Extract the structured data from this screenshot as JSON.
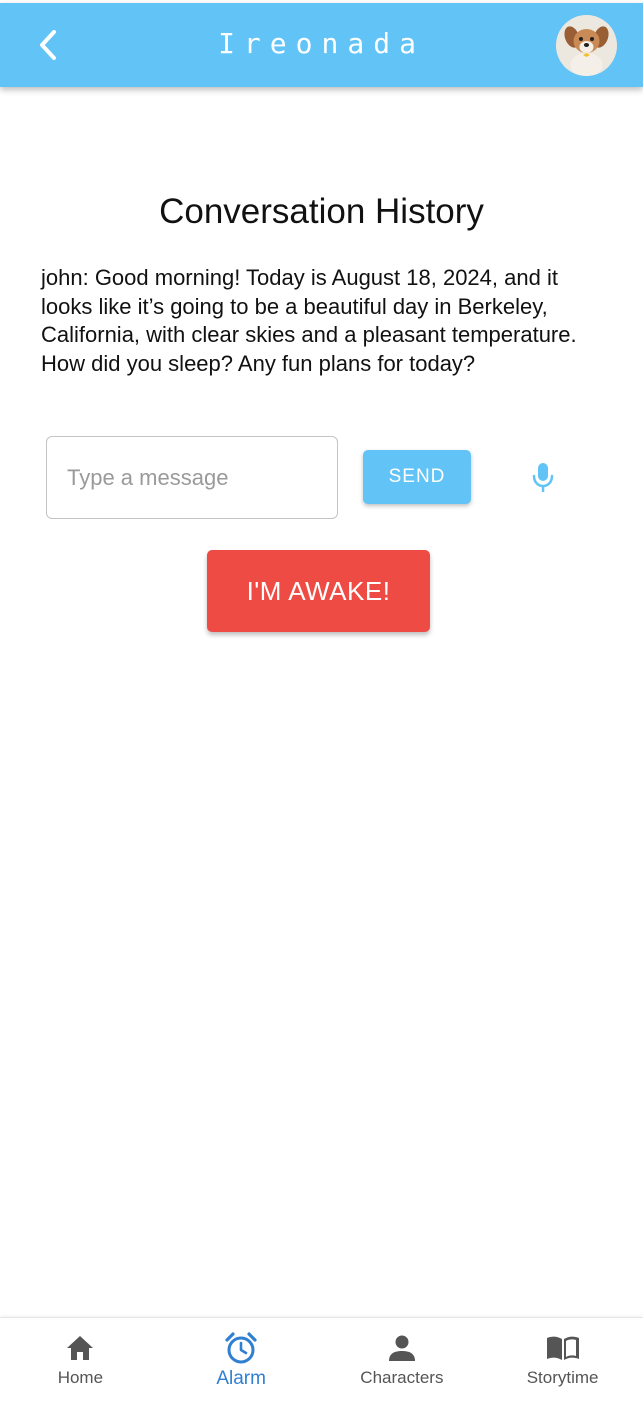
{
  "header": {
    "title": "Ireonada",
    "background_color": "#62c3f7",
    "back_icon": "chevron-left-icon",
    "avatar": "puppy-avatar"
  },
  "main": {
    "heading": "Conversation History",
    "messages": [
      {
        "text": "john: Good morning! Today is August 18, 2024, and it looks like it’s going to be a beautiful day in Berkeley, California, with clear skies and a pleasant temperature. How did you sleep? Any fun plans for today?"
      }
    ],
    "input": {
      "placeholder": "Type a message",
      "value": ""
    },
    "send_label": "SEND",
    "mic_icon": "microphone-icon",
    "awake_label": "I'M AWAKE!",
    "awake_color": "#ee4b44",
    "accent_color": "#62c3f7"
  },
  "bottom_nav": {
    "active": "Alarm",
    "active_color": "#2f7fd2",
    "items": [
      {
        "label": "Home",
        "icon": "home-icon"
      },
      {
        "label": "Alarm",
        "icon": "alarm-clock-icon"
      },
      {
        "label": "Characters",
        "icon": "person-icon"
      },
      {
        "label": "Storytime",
        "icon": "open-book-icon"
      }
    ]
  }
}
